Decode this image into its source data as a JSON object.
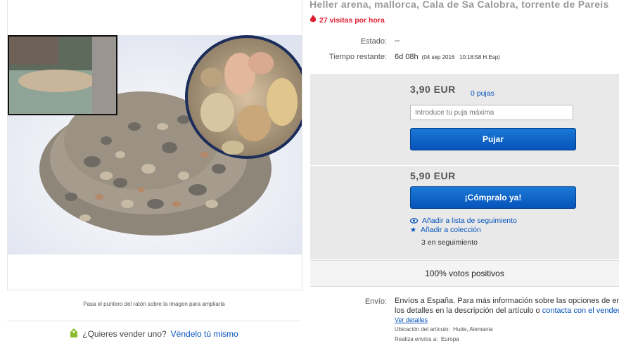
{
  "listing": {
    "title": "Heller arena, mallorca, Cala de Sa Calobra, torrente de Pareis",
    "visits": "27 visitas por hora"
  },
  "image": {
    "caption": "Pasa el puntero del ratón sobre la imagen para ampliarla"
  },
  "sell": {
    "question": "¿Quieres vender uno?",
    "link": "Véndelo tú mismo"
  },
  "details": {
    "estado_label": "Estado:",
    "estado_value": "--",
    "tiempo_label": "Tiempo restante:",
    "tiempo_value": "6d 08h",
    "tiempo_detail": "(04 sep 2016   10:18:58 H.Esp)"
  },
  "bid": {
    "price": "3,90 EUR",
    "pujas": "0 pujas",
    "placeholder": "Introduce tu puja máxima",
    "button": "Pujar"
  },
  "buy": {
    "price": "5,90 EUR",
    "button": "¡Cómpralo ya!",
    "watchlist": "Añadir a lista de seguimiento",
    "collection": "Añadir a colección",
    "following": "3 en seguimiento"
  },
  "feedback": "100% votos positivos",
  "shipping": {
    "label": "Envío:",
    "line1": "Envíos a España. Para más información sobre las opciones de envío,",
    "line2_pre": "los detalles en la descripción del artículo o",
    "line2_link": "contacta con el vendedor",
    "details_link": "Ver detalles",
    "location": "Ubicación del artículo:  Hude, Alemania",
    "ships_to": "Realiza envíos a:  Europa"
  },
  "colors": {
    "accent": "#0654ba",
    "alert": "#dd1e31"
  }
}
